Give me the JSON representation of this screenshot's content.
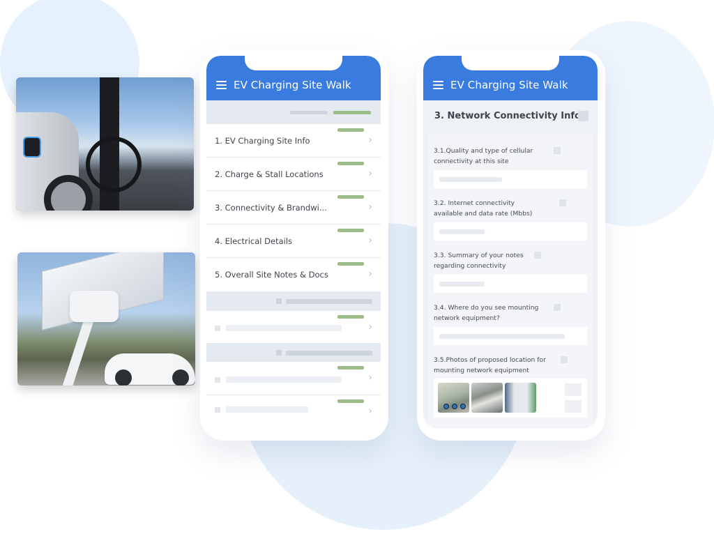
{
  "app": {
    "title": "EV Charging Site Walk",
    "brand_color": "#3a7be0",
    "progress_color": "#9dbd88"
  },
  "phone_left": {
    "menu_icon": "hamburger-icon",
    "sections": [
      {
        "label": "1. EV Charging Site Info",
        "icon": "chevron-right-icon"
      },
      {
        "label": "2. Charge & Stall Locations",
        "icon": "chevron-right-icon"
      },
      {
        "label": "3. Connectivity & Brandwi...",
        "icon": "chevron-right-icon"
      },
      {
        "label": "4. Electrical Details",
        "icon": "chevron-right-icon"
      },
      {
        "label": "5. Overall Site Notes & Docs",
        "icon": "chevron-right-icon"
      }
    ],
    "chevron": "›"
  },
  "phone_right": {
    "menu_icon": "hamburger-icon",
    "section_title": "3. Network Connectivity Info",
    "questions": [
      {
        "label": "3.1.Quality and type of cellular connectivity at this site",
        "type": "text"
      },
      {
        "label": "3.2. Internet connectivity available and data rate (Mbbs)",
        "type": "text"
      },
      {
        "label": "3.3. Summary of your notes regarding connectivity",
        "type": "text"
      },
      {
        "label": "3.4. Where do you see mounting network equipment?",
        "type": "text"
      },
      {
        "label": "3.5.Photos of proposed location for mounting network equipment",
        "type": "photos",
        "photo_count": 3
      }
    ]
  },
  "images": [
    {
      "description": "Electric car charging at a pole-mounted charger"
    },
    {
      "description": "Solar canopy EV charger with white car in parking lot"
    }
  ]
}
